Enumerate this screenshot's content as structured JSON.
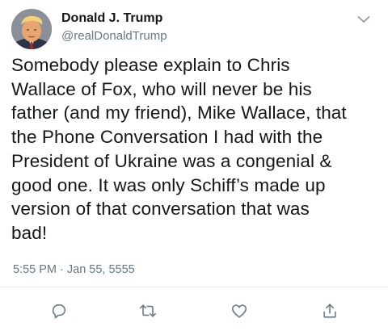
{
  "tweet": {
    "author": {
      "display_name": "Donald J. Trump",
      "handle": "@realDonaldTrump"
    },
    "text": "Somebody please explain to Chris\nWallace of Fox, who will never be his\nfather (and my friend), Mike Wallace, that\nthe Phone Conversation I had with the\nPresident of Ukraine was a congenial &\ngood one. It was only Schiff’s made up\nversion of that conversation that was\nbad!",
    "timestamp": "5:55 PM · Jan 55, 5555"
  },
  "icons": {
    "caret": "chevron-down-icon",
    "reply": "reply-icon",
    "retweet": "retweet-icon",
    "like": "heart-icon",
    "share": "share-icon"
  },
  "colors": {
    "primary_text": "#14171a",
    "secondary_text": "#657786",
    "icon": "#657786",
    "divider": "#e6ecf0"
  }
}
